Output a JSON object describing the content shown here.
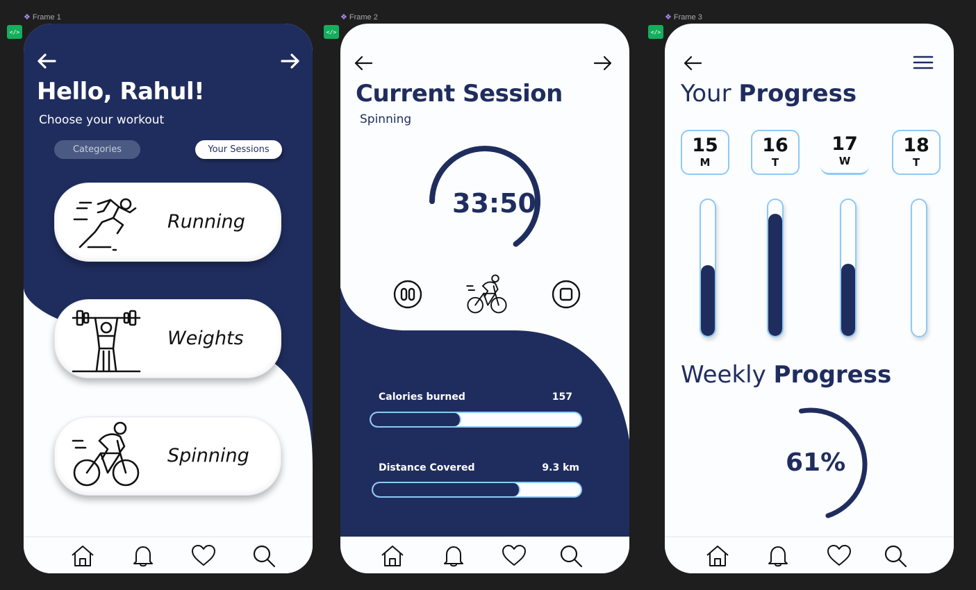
{
  "frames": [
    {
      "label": "Frame 1"
    },
    {
      "label": "Frame 2"
    },
    {
      "label": "Frame 3"
    }
  ],
  "code_badge": "</>",
  "colors": {
    "navy": "#1f2d5e",
    "accent_light_blue": "#8ec9f5",
    "background": "#fbfdff",
    "canvas": "#1e1e1e"
  },
  "screen1": {
    "greeting": "Hello, Rahul!",
    "subtitle": "Choose your workout",
    "tabs": [
      {
        "label": "Categories",
        "selected": false
      },
      {
        "label": "Your Sessions",
        "selected": true
      }
    ],
    "workouts": [
      {
        "label": "Running",
        "icon": "running-person-icon"
      },
      {
        "label": "Weights",
        "icon": "weightlifter-icon"
      },
      {
        "label": "Spinning",
        "icon": "cyclist-icon"
      }
    ]
  },
  "screen2": {
    "title": "Current Session",
    "activity": "Spinning",
    "timer": "33:50",
    "timer_progress_percent": 65,
    "controls": [
      "pause-icon",
      "cyclist-icon",
      "stop-icon"
    ],
    "stats": [
      {
        "label": "Calories burned",
        "value": "157",
        "progress_percent": 43
      },
      {
        "label": "Distance Covered",
        "value": "9.3 km",
        "progress_percent": 71
      }
    ]
  },
  "screen3": {
    "title_light": "Your",
    "title_bold": "Progress",
    "days": [
      {
        "num": "15",
        "weekday": "M",
        "selected": false,
        "level_percent": 52
      },
      {
        "num": "16",
        "weekday": "T",
        "selected": false,
        "level_percent": 90
      },
      {
        "num": "17",
        "weekday": "W",
        "selected": true,
        "level_percent": 53
      },
      {
        "num": "18",
        "weekday": "T",
        "selected": false,
        "level_percent": 0
      }
    ],
    "weekly_light": "Weekly",
    "weekly_bold": "Progress",
    "weekly_percent_text": "61%",
    "weekly_percent": 61
  },
  "bottom_nav": [
    "home-icon",
    "bell-icon",
    "heart-icon",
    "search-icon"
  ]
}
